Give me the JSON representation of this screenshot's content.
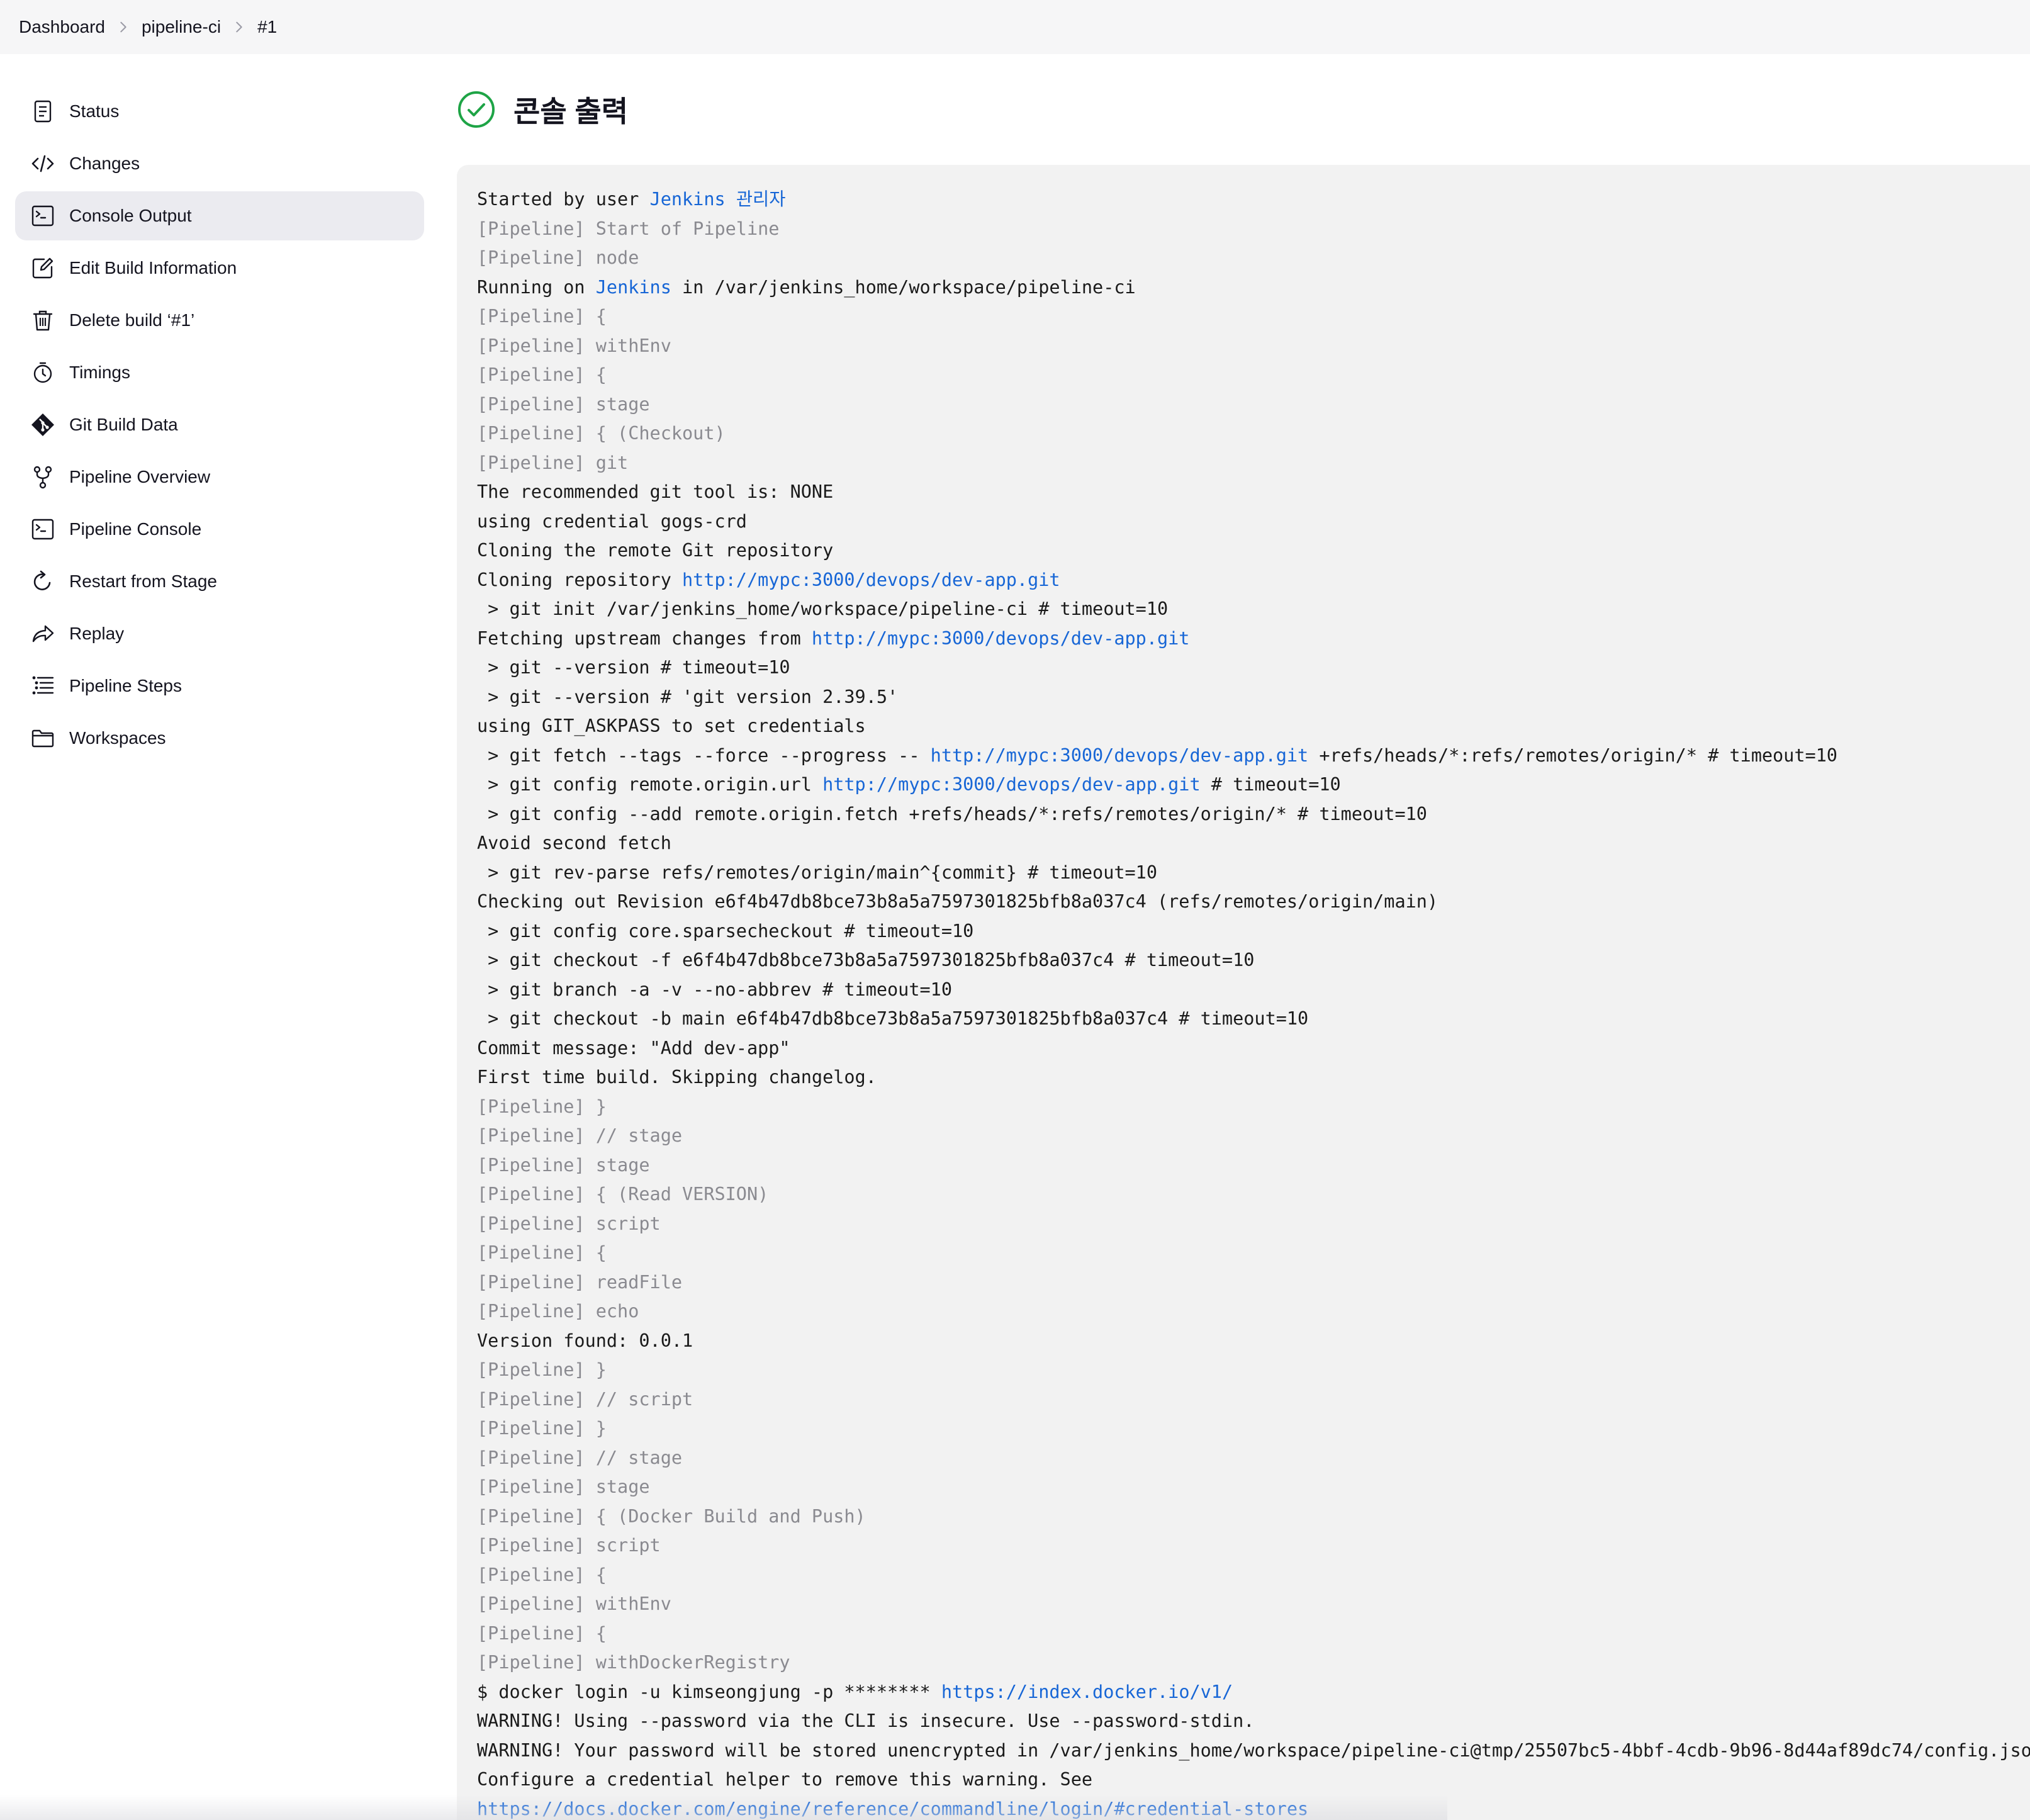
{
  "breadcrumb": [
    "Dashboard",
    "pipeline-ci",
    "#1"
  ],
  "sidebar": {
    "active_index": 2,
    "items": [
      {
        "label": "Status",
        "icon": "document-icon"
      },
      {
        "label": "Changes",
        "icon": "code-icon"
      },
      {
        "label": "Console Output",
        "icon": "terminal-icon"
      },
      {
        "label": "Edit Build Information",
        "icon": "edit-icon"
      },
      {
        "label": "Delete build ‘#1’",
        "icon": "trash-icon"
      },
      {
        "label": "Timings",
        "icon": "stopwatch-icon"
      },
      {
        "label": "Git Build Data",
        "icon": "git-icon"
      },
      {
        "label": "Pipeline Overview",
        "icon": "branch-icon"
      },
      {
        "label": "Pipeline Console",
        "icon": "terminal-icon"
      },
      {
        "label": "Restart from Stage",
        "icon": "restart-icon"
      },
      {
        "label": "Replay",
        "icon": "replay-icon"
      },
      {
        "label": "Pipeline Steps",
        "icon": "steps-icon"
      },
      {
        "label": "Workspaces",
        "icon": "folder-icon"
      }
    ]
  },
  "page": {
    "title": "콘솔 출력",
    "status_icon": "success-check-icon",
    "status_color": "#1ea446"
  },
  "colors": {
    "link": "#1766d6",
    "meta_text": "#8a8a90",
    "console_bg": "#f2f2f2",
    "active_item_bg": "#ebebf0"
  },
  "console": {
    "lines": [
      [
        {
          "t": "Started by user "
        },
        {
          "t": "Jenkins 관리자",
          "link": true
        }
      ],
      [
        {
          "t": "[Pipeline] Start of Pipeline",
          "meta": true
        }
      ],
      [
        {
          "t": "[Pipeline] node",
          "meta": true
        }
      ],
      [
        {
          "t": "Running on "
        },
        {
          "t": "Jenkins",
          "link": true
        },
        {
          "t": " in /var/jenkins_home/workspace/pipeline-ci"
        }
      ],
      [
        {
          "t": "[Pipeline] {",
          "meta": true
        }
      ],
      [
        {
          "t": "[Pipeline] withEnv",
          "meta": true
        }
      ],
      [
        {
          "t": "[Pipeline] {",
          "meta": true
        }
      ],
      [
        {
          "t": "[Pipeline] stage",
          "meta": true
        }
      ],
      [
        {
          "t": "[Pipeline] { (Checkout)",
          "meta": true
        }
      ],
      [
        {
          "t": "[Pipeline] git",
          "meta": true
        }
      ],
      [
        {
          "t": "The recommended git tool is: NONE"
        }
      ],
      [
        {
          "t": "using credential gogs-crd"
        }
      ],
      [
        {
          "t": "Cloning the remote Git repository"
        }
      ],
      [
        {
          "t": "Cloning repository "
        },
        {
          "t": "http://mypc:3000/devops/dev-app.git",
          "link": true
        }
      ],
      [
        {
          "t": " > git init /var/jenkins_home/workspace/pipeline-ci # timeout=10"
        }
      ],
      [
        {
          "t": "Fetching upstream changes from "
        },
        {
          "t": "http://mypc:3000/devops/dev-app.git",
          "link": true
        }
      ],
      [
        {
          "t": " > git --version # timeout=10"
        }
      ],
      [
        {
          "t": " > git --version # 'git version 2.39.5'"
        }
      ],
      [
        {
          "t": "using GIT_ASKPASS to set credentials"
        }
      ],
      [
        {
          "t": " > git fetch --tags --force --progress -- "
        },
        {
          "t": "http://mypc:3000/devops/dev-app.git",
          "link": true
        },
        {
          "t": " +refs/heads/*:refs/remotes/origin/* # timeout=10"
        }
      ],
      [
        {
          "t": " > git config remote.origin.url "
        },
        {
          "t": "http://mypc:3000/devops/dev-app.git",
          "link": true
        },
        {
          "t": " # timeout=10"
        }
      ],
      [
        {
          "t": " > git config --add remote.origin.fetch +refs/heads/*:refs/remotes/origin/* # timeout=10"
        }
      ],
      [
        {
          "t": "Avoid second fetch"
        }
      ],
      [
        {
          "t": " > git rev-parse refs/remotes/origin/main^{commit} # timeout=10"
        }
      ],
      [
        {
          "t": "Checking out Revision e6f4b47db8bce73b8a5a7597301825bfb8a037c4 (refs/remotes/origin/main)"
        }
      ],
      [
        {
          "t": " > git config core.sparsecheckout # timeout=10"
        }
      ],
      [
        {
          "t": " > git checkout -f e6f4b47db8bce73b8a5a7597301825bfb8a037c4 # timeout=10"
        }
      ],
      [
        {
          "t": " > git branch -a -v --no-abbrev # timeout=10"
        }
      ],
      [
        {
          "t": " > git checkout -b main e6f4b47db8bce73b8a5a7597301825bfb8a037c4 # timeout=10"
        }
      ],
      [
        {
          "t": "Commit message: \"Add dev-app\""
        }
      ],
      [
        {
          "t": "First time build. Skipping changelog."
        }
      ],
      [
        {
          "t": "[Pipeline] }",
          "meta": true
        }
      ],
      [
        {
          "t": "[Pipeline] // stage",
          "meta": true
        }
      ],
      [
        {
          "t": "[Pipeline] stage",
          "meta": true
        }
      ],
      [
        {
          "t": "[Pipeline] { (Read VERSION)",
          "meta": true
        }
      ],
      [
        {
          "t": "[Pipeline] script",
          "meta": true
        }
      ],
      [
        {
          "t": "[Pipeline] {",
          "meta": true
        }
      ],
      [
        {
          "t": "[Pipeline] readFile",
          "meta": true
        }
      ],
      [
        {
          "t": "[Pipeline] echo",
          "meta": true
        }
      ],
      [
        {
          "t": "Version found: 0.0.1"
        }
      ],
      [
        {
          "t": "[Pipeline] }",
          "meta": true
        }
      ],
      [
        {
          "t": "[Pipeline] // script",
          "meta": true
        }
      ],
      [
        {
          "t": "[Pipeline] }",
          "meta": true
        }
      ],
      [
        {
          "t": "[Pipeline] // stage",
          "meta": true
        }
      ],
      [
        {
          "t": "[Pipeline] stage",
          "meta": true
        }
      ],
      [
        {
          "t": "[Pipeline] { (Docker Build and Push)",
          "meta": true
        }
      ],
      [
        {
          "t": "[Pipeline] script",
          "meta": true
        }
      ],
      [
        {
          "t": "[Pipeline] {",
          "meta": true
        }
      ],
      [
        {
          "t": "[Pipeline] withEnv",
          "meta": true
        }
      ],
      [
        {
          "t": "[Pipeline] {",
          "meta": true
        }
      ],
      [
        {
          "t": "[Pipeline] withDockerRegistry",
          "meta": true
        }
      ],
      [
        {
          "t": "$ docker login -u kimseongjung -p ******** "
        },
        {
          "t": "https://index.docker.io/v1/",
          "link": true
        }
      ],
      [
        {
          "t": "WARNING! Using --password via the CLI is insecure. Use --password-stdin."
        }
      ],
      [
        {
          "t": "WARNING! Your password will be stored unencrypted in /var/jenkins_home/workspace/pipeline-ci@tmp/25507bc5-4bbf-4cdb-9b96-8d44af89dc74/config.json."
        }
      ],
      [
        {
          "t": "Configure a credential helper to remove this warning. See"
        }
      ],
      [
        {
          "t": "https://docs.docker.com/engine/reference/commandline/login/#credential-stores",
          "link": true
        }
      ]
    ]
  }
}
